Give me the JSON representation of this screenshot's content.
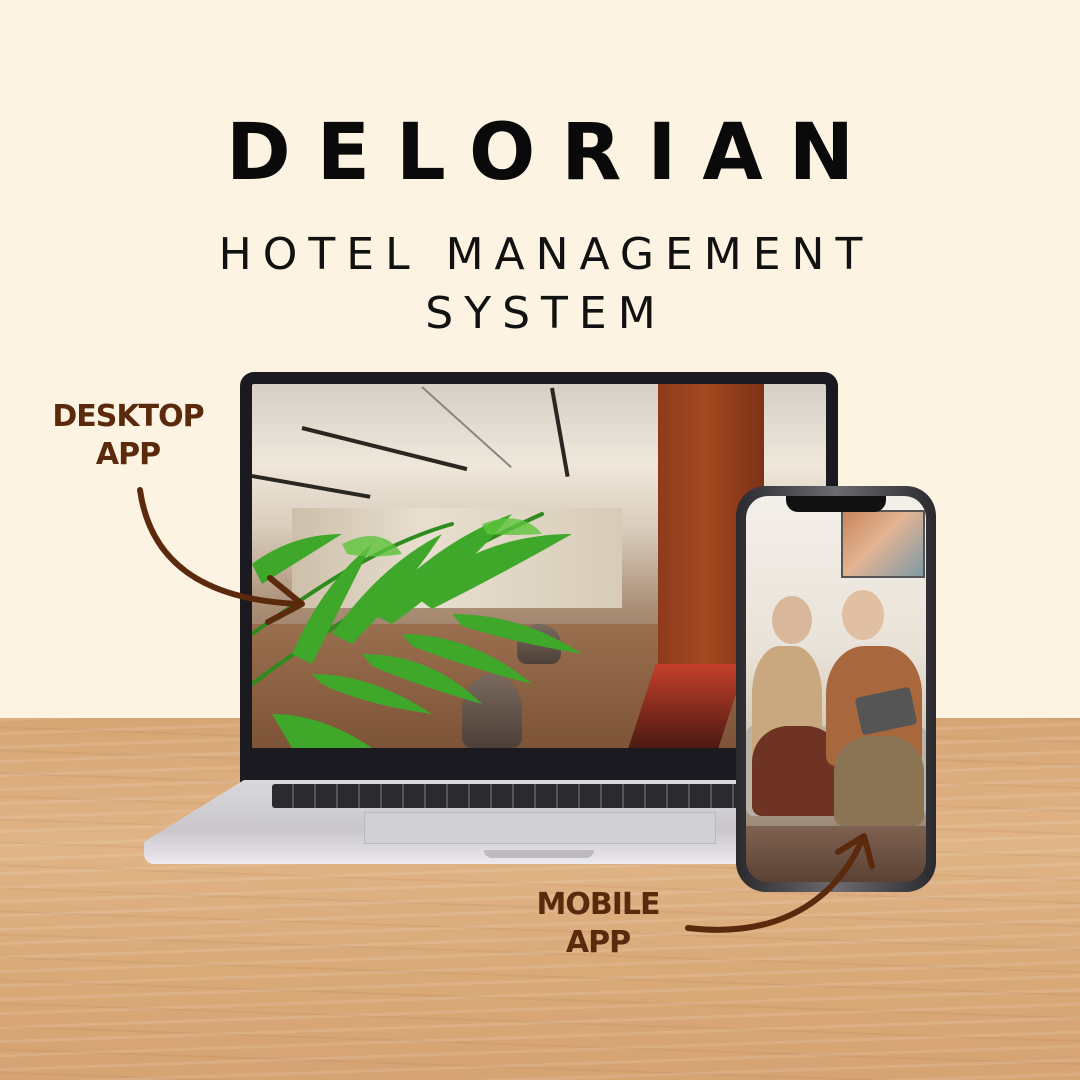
{
  "brand": {
    "title": "DELORIAN",
    "subtitle_line1": "HOTEL MANAGEMENT",
    "subtitle_line2": "SYSTEM"
  },
  "labels": {
    "desktop_line1": "DESKTOP",
    "desktop_line2": "APP",
    "mobile_line1": "MOBILE",
    "mobile_line2": "APP"
  },
  "colors": {
    "background": "#fdf3e3",
    "title": "#0a0a0a",
    "label": "#5b2a0d",
    "arrow": "#5b2a0d",
    "table": "#d9a978"
  },
  "images": {
    "laptop_screen": "hotel-lobby-photo",
    "phone_screen": "senior-couple-with-tablet-photo"
  }
}
